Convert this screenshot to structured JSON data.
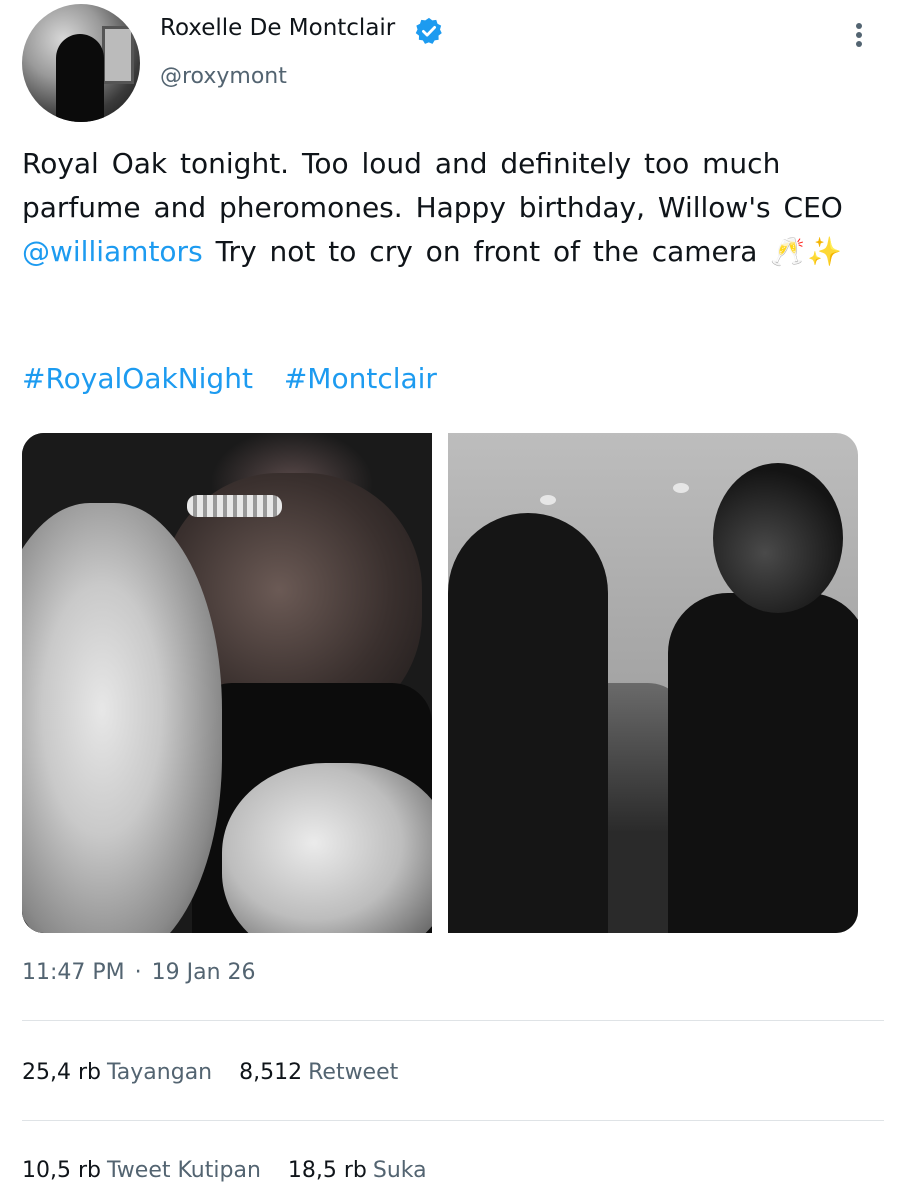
{
  "author": {
    "display_name": "Roxelle De Montclair",
    "handle": "@roxymont",
    "verified_icon": "verified-badge-icon",
    "avatar": "profile-photo"
  },
  "menu": {
    "icon": "more-vertical-icon"
  },
  "tweet": {
    "text_part1": "Royal Oak tonight. Too loud and definitely too much parfume and pheromones. Happy birthday, Willow's CEO ",
    "mention": "@williamtors",
    "text_part2": " Try not to cry on front of the camera ",
    "emoji": "🥂✨",
    "hashtags": [
      "#RoyalOakNight",
      "#Montclair"
    ]
  },
  "media": {
    "photos": [
      "photo-1",
      "photo-2"
    ]
  },
  "meta": {
    "time": "11:47 PM",
    "separator": "·",
    "date": "19 Jan 26"
  },
  "stats": {
    "views_value": "25,4 rb",
    "views_label": "Tayangan",
    "retweets_value": "8,512",
    "retweets_label": "Retweet",
    "quotes_value": "10,5 rb",
    "quotes_label": "Tweet Kutipan",
    "likes_value": "18,5 rb",
    "likes_label": "Suka"
  },
  "colors": {
    "link": "#1d9bf0",
    "secondary_text": "#536471",
    "primary_text": "#0f1419",
    "divider": "#dfe3e6"
  }
}
